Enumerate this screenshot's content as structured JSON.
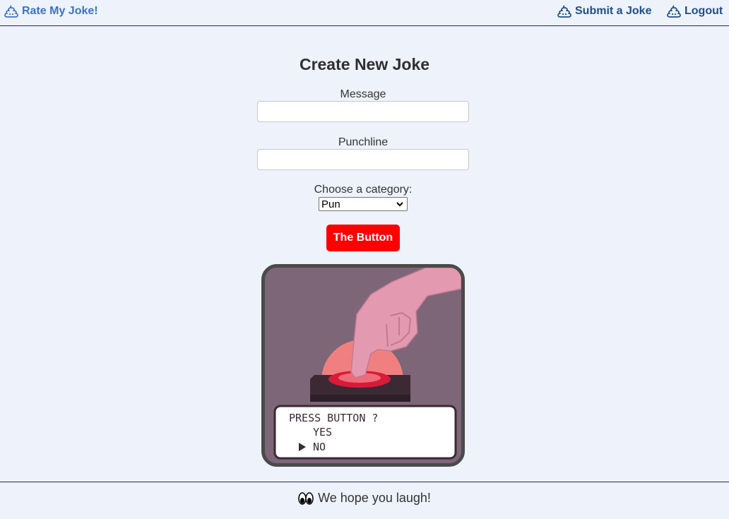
{
  "nav": {
    "brand": "Rate My Joke!",
    "submit": "Submit a Joke",
    "logout": "Logout",
    "icon": "poop-icon"
  },
  "form": {
    "title": "Create New Joke",
    "message_label": "Message",
    "message_value": "",
    "punchline_label": "Punchline",
    "punchline_value": "",
    "category_label": "Choose a category:",
    "category_selected": "Pun",
    "submit_label": "The Button"
  },
  "illustration": {
    "dialog_question": "PRESS BUTTON ?",
    "option_yes": "YES",
    "option_no": "NO"
  },
  "footer": {
    "text": "We hope you laugh!",
    "icon": "eyes-icon"
  },
  "colors": {
    "background": "#edf2fb",
    "accent": "#ff0000",
    "nav_link": "#1f4e8c",
    "brand": "#3b73c9",
    "divider": "#2b1d86"
  }
}
